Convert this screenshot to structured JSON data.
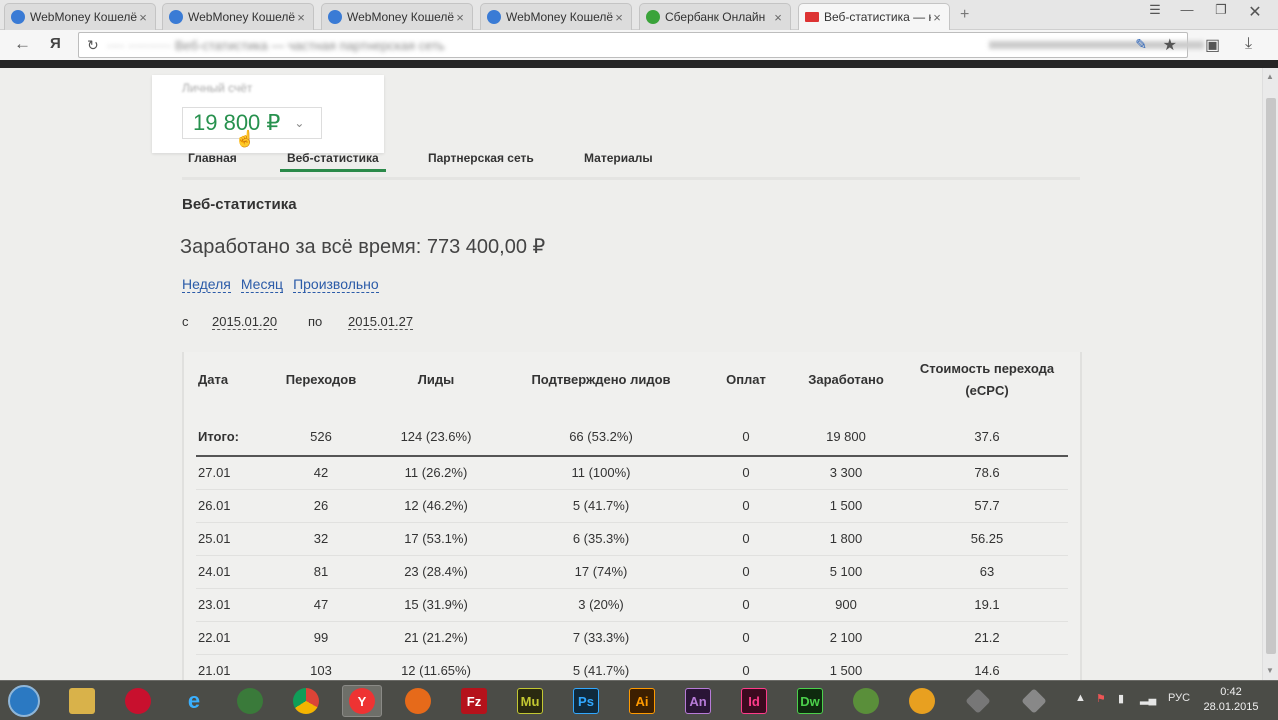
{
  "tabs": [
    {
      "title": "WebMoney Кошелёк -",
      "fav_color": "#3a7bd5"
    },
    {
      "title": "WebMoney Кошелёк -",
      "fav_color": "#3a7bd5"
    },
    {
      "title": "WebMoney Кошелёк -",
      "fav_color": "#3a7bd5"
    },
    {
      "title": "WebMoney Кошелёк -",
      "fav_color": "#3a7bd5"
    },
    {
      "title": "Сбербанк Онлайн",
      "fav_color": "#3aa33a"
    },
    {
      "title": "Веб-статистика — ка",
      "fav_color": "#d33"
    }
  ],
  "toolbar": {
    "yandex": "Я",
    "url": "···· ·········· Веб-статистика — частная партнерская сеть"
  },
  "account": {
    "label": "Личный счёт",
    "balance": "19 800 ₽"
  },
  "nav": {
    "items": [
      "Главная",
      "Веб-статистика",
      "Партнерская сеть",
      "Материалы"
    ],
    "active_index": 1
  },
  "page": {
    "title": "Веб-статистика",
    "earned": "Заработано за всё время: 773 400,00 ₽",
    "periods": [
      "Неделя",
      "Месяц",
      "Произвольно"
    ],
    "from_label": "с",
    "from_date": "2015.01.20",
    "to_label": "по",
    "to_date": "2015.01.27"
  },
  "table": {
    "headers": [
      "Дата",
      "Переходов",
      "Лиды",
      "Подтверждено лидов",
      "Оплат",
      "Заработано",
      "Стоимость перехода (eCPC)"
    ],
    "total": [
      "Итого:",
      "526",
      "124  (23.6%)",
      "66 (53.2%)",
      "0",
      "19 800",
      "37.6"
    ],
    "rows": [
      [
        "27.01",
        "42",
        "11 (26.2%)",
        "11 (100%)",
        "0",
        "3 300",
        "78.6"
      ],
      [
        "26.01",
        "26",
        "12 (46.2%)",
        "5 (41.7%)",
        "0",
        "1 500",
        "57.7"
      ],
      [
        "25.01",
        "32",
        "17 (53.1%)",
        "6 (35.3%)",
        "0",
        "1 800",
        "56.25"
      ],
      [
        "24.01",
        "81",
        "23 (28.4%)",
        "17 (74%)",
        "0",
        "5 100",
        "63"
      ],
      [
        "23.01",
        "47",
        "15 (31.9%)",
        "3 (20%)",
        "0",
        "900",
        "19.1"
      ],
      [
        "22.01",
        "99",
        "21 (21.2%)",
        "7 (33.3%)",
        "0",
        "2 100",
        "21.2"
      ],
      [
        "21.01",
        "103",
        "12 (11.65%)",
        "5 (41.7%)",
        "0",
        "1 500",
        "14.6"
      ]
    ]
  },
  "taskbar": {
    "apps": [
      "Fz",
      "Mu",
      "Ps",
      "Ai",
      "An",
      "Id",
      "Dw"
    ],
    "lang": "РУС",
    "time": "0:42",
    "date": "28.01.2015"
  }
}
